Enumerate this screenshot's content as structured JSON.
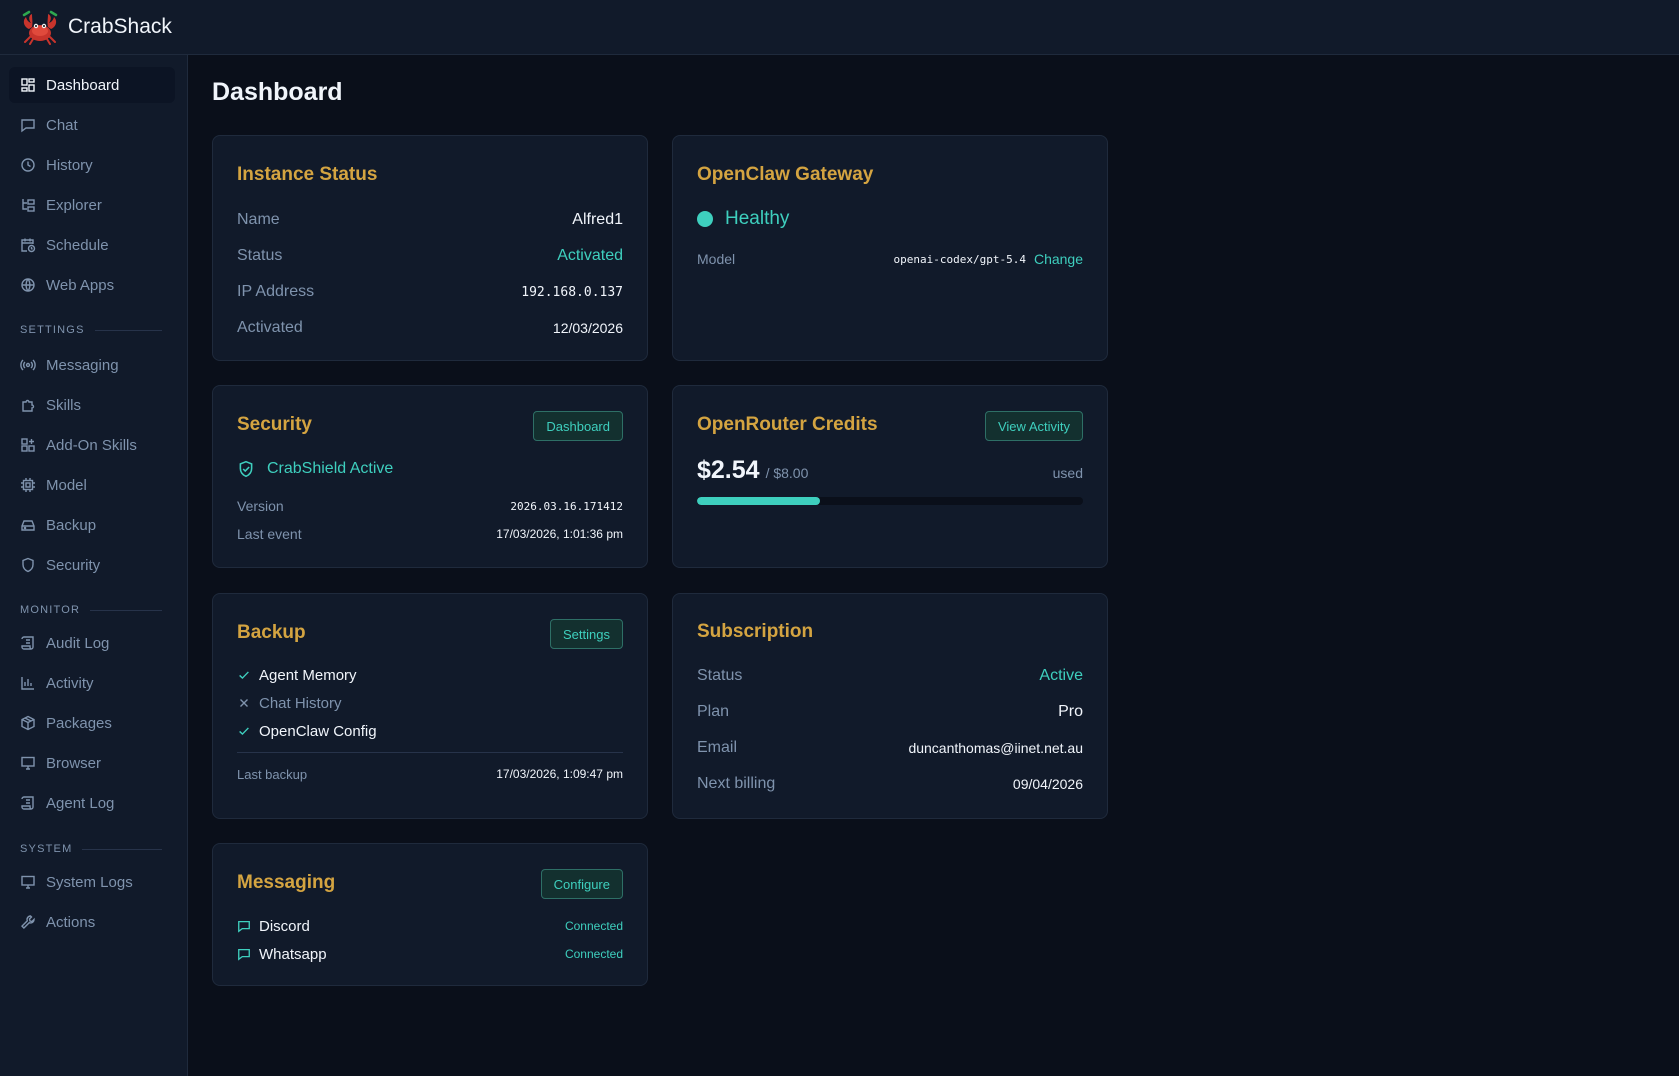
{
  "app": {
    "name": "CrabShack"
  },
  "sidebar": {
    "main_items": [
      {
        "label": "Dashboard",
        "icon": "dashboard-icon"
      },
      {
        "label": "Chat",
        "icon": "chat-icon"
      },
      {
        "label": "History",
        "icon": "clock-icon"
      },
      {
        "label": "Explorer",
        "icon": "folder-tree-icon"
      },
      {
        "label": "Schedule",
        "icon": "calendar-clock-icon"
      },
      {
        "label": "Web Apps",
        "icon": "globe-icon"
      }
    ],
    "settings_label": "SETTINGS",
    "settings_items": [
      {
        "label": "Messaging",
        "icon": "radio-icon"
      },
      {
        "label": "Skills",
        "icon": "puzzle-icon"
      },
      {
        "label": "Add-On Skills",
        "icon": "grid-plus-icon"
      },
      {
        "label": "Model",
        "icon": "cpu-icon"
      },
      {
        "label": "Backup",
        "icon": "hard-drive-icon"
      },
      {
        "label": "Security",
        "icon": "shield-icon"
      }
    ],
    "monitor_label": "MONITOR",
    "monitor_items": [
      {
        "label": "Audit Log",
        "icon": "scroll-icon"
      },
      {
        "label": "Activity",
        "icon": "bar-chart-icon"
      },
      {
        "label": "Packages",
        "icon": "package-icon"
      },
      {
        "label": "Browser",
        "icon": "monitor-icon"
      },
      {
        "label": "Agent Log",
        "icon": "scroll-icon"
      }
    ],
    "system_label": "SYSTEM",
    "system_items": [
      {
        "label": "System Logs",
        "icon": "monitor-icon"
      },
      {
        "label": "Actions",
        "icon": "wrench-icon"
      }
    ]
  },
  "page": {
    "title": "Dashboard"
  },
  "instance_status": {
    "title": "Instance Status",
    "name_label": "Name",
    "name_value": "Alfred1",
    "status_label": "Status",
    "status_value": "Activated",
    "ip_label": "IP Address",
    "ip_value": "192.168.0.137",
    "activated_label": "Activated",
    "activated_value": "12/03/2026"
  },
  "gateway": {
    "title": "OpenClaw Gateway",
    "health": "Healthy",
    "model_label": "Model",
    "model_value": "openai-codex/gpt-5.4",
    "change_label": "Change"
  },
  "security": {
    "title": "Security",
    "button_label": "Dashboard",
    "shield_status": "CrabShield Active",
    "version_label": "Version",
    "version_value": "2026.03.16.171412",
    "last_event_label": "Last event",
    "last_event_value": "17/03/2026, 1:01:36 pm"
  },
  "credits": {
    "title": "OpenRouter Credits",
    "button_label": "View Activity",
    "used_amount": "$2.54",
    "total": "/ $8.00",
    "used_label": "used",
    "used_fraction": 0.3175
  },
  "backup": {
    "title": "Backup",
    "button_label": "Settings",
    "items": [
      {
        "label": "Agent Memory",
        "enabled": true
      },
      {
        "label": "Chat History",
        "enabled": false
      },
      {
        "label": "OpenClaw Config",
        "enabled": true
      }
    ],
    "last_backup_label": "Last backup",
    "last_backup_value": "17/03/2026, 1:09:47 pm"
  },
  "subscription": {
    "title": "Subscription",
    "status_label": "Status",
    "status_value": "Active",
    "plan_label": "Plan",
    "plan_value": "Pro",
    "email_label": "Email",
    "email_value": "duncanthomas@iinet.net.au",
    "billing_label": "Next billing",
    "billing_value": "09/04/2026"
  },
  "messaging": {
    "title": "Messaging",
    "button_label": "Configure",
    "channels": [
      {
        "label": "Discord",
        "status": "Connected"
      },
      {
        "label": "Whatsapp",
        "status": "Connected"
      }
    ]
  },
  "colors": {
    "background": "#0a0f1a",
    "panel": "#111a2a",
    "accent_teal": "#3ecfbe",
    "heading_gold": "#d4a441",
    "muted": "#7f93ad"
  }
}
